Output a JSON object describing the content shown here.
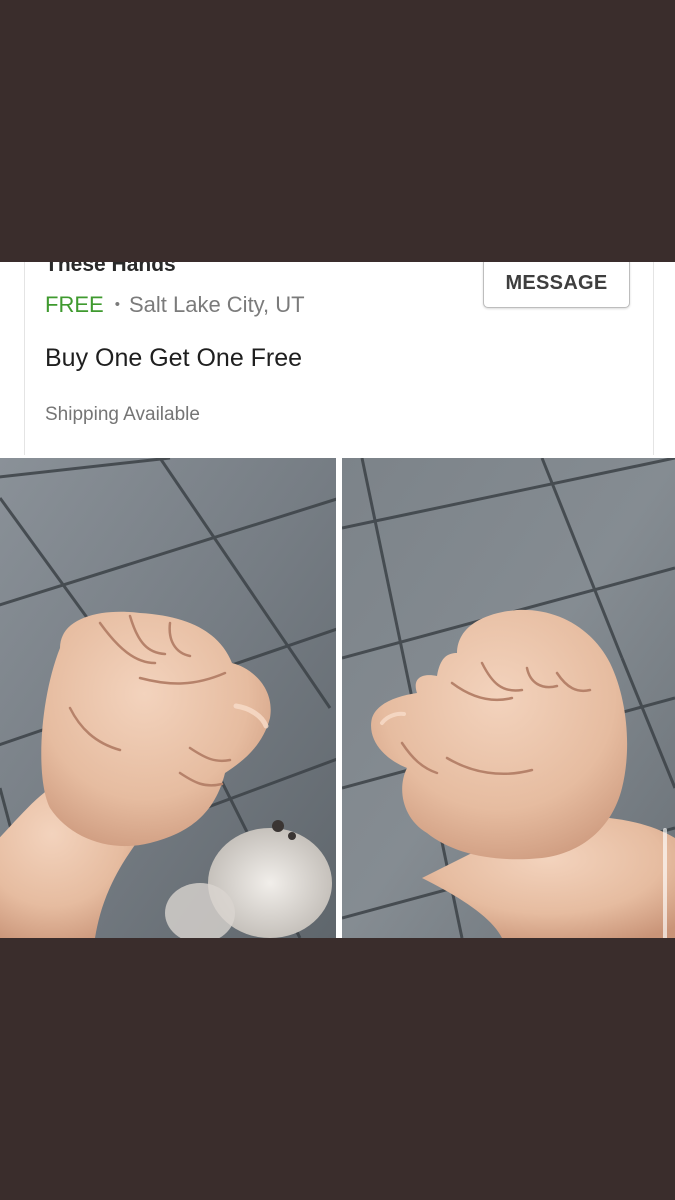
{
  "listing": {
    "title": "These Hands",
    "price": "FREE",
    "separator": "•",
    "location": "Salt Lake City, UT",
    "description": "Buy One Get One Free",
    "shipping": "Shipping Available",
    "message_button": "MESSAGE"
  },
  "photos": [
    {
      "name": "fist-photo-left",
      "subject": "clenched fist on tiled floor"
    },
    {
      "name": "fist-photo-right",
      "subject": "clenched fist on tiled floor"
    }
  ],
  "colors": {
    "page_background": "#3a2d2c",
    "price_green": "#3f9a2f",
    "skin": "#e8bfa3",
    "tile": "#7e858c",
    "grout": "#3c4247"
  }
}
